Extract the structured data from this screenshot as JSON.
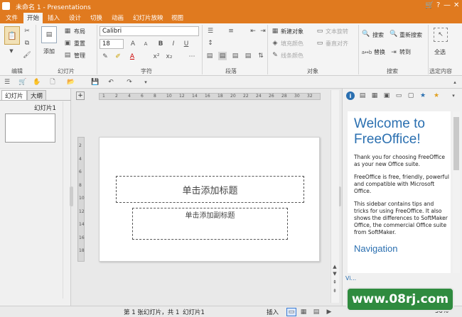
{
  "title": {
    "doc": "未命名 1 - Presentations"
  },
  "menu": [
    "文件",
    "开始",
    "插入",
    "设计",
    "切换",
    "动画",
    "幻灯片放映",
    "视图"
  ],
  "ribbon": {
    "add_label": "添加",
    "layout": "布局",
    "reset": "重置",
    "manage": "管理",
    "font_name": "Calibri",
    "font_size": "18",
    "new_object": "新建对象",
    "text_rotate": "文本旋转",
    "fill_color": "填充颜色",
    "vertical_align": "垂直对齐",
    "line_color": "线条颜色",
    "search": "搜索",
    "replace_search": "重新搜索",
    "replace": "替换",
    "goto": "转到",
    "select_all": "全选",
    "groups": [
      "编辑",
      "幻灯片",
      "字符",
      "段落",
      "对象",
      "搜索",
      "选定内容"
    ]
  },
  "left_panel": {
    "tabs": [
      "幻灯片",
      "大纲"
    ],
    "slide_label": "幻灯片1"
  },
  "slide": {
    "title_placeholder": "单击添加标题",
    "subtitle_placeholder": "单击添加副标题"
  },
  "ruler": {
    "h_ticks": [
      "1",
      "2",
      "4",
      "6",
      "8",
      "10",
      "12",
      "14",
      "16",
      "18",
      "20",
      "22",
      "24",
      "26",
      "28",
      "30",
      "32"
    ],
    "v_ticks": [
      "2",
      "4",
      "6",
      "8",
      "10",
      "12",
      "14",
      "16",
      "18"
    ]
  },
  "sidebar": {
    "heading": "Welcome to FreeOffice!",
    "p1": "Thank you for choosing FreeOffice as your new Office suite.",
    "p2": "FreeOffice is free, friendly, powerful and compatible with Microsoft Office.",
    "p3": "This sidebar contains tips and tricks for using FreeOffice. It also shows the differences to SoftMaker Office, the commercial Office suite from SoftMaker.",
    "nav_heading": "Navigation",
    "nav_link": "Vi..."
  },
  "status": {
    "slide_info": "第 1 张幻灯片，共 1",
    "slide_name": "幻灯片1",
    "mode": "插入",
    "zoom": "56%"
  },
  "watermark": {
    "text": "www.08rj.com"
  },
  "colors": {
    "accent": "#e07a1f",
    "heading_blue": "#2a6fb0",
    "watermark_green": "#2f8b3f"
  }
}
